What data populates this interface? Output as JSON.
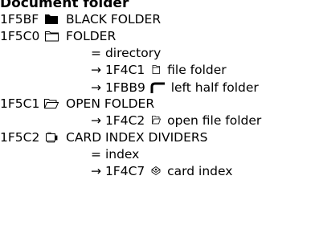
{
  "header": {
    "title": "Document folder"
  },
  "entries": [
    {
      "code": "1F5BF",
      "glyph": "🖿",
      "glyph_icon": "black-folder-icon",
      "name": "BLACK FOLDER",
      "notes": []
    },
    {
      "code": "1F5C0",
      "glyph": "🗀",
      "glyph_icon": "folder-icon",
      "name": "FOLDER",
      "notes": [
        {
          "prefix": "=",
          "text": "directory"
        },
        {
          "prefix": "→",
          "ref_code": "1F4C1",
          "ref_glyph": "📁",
          "text": "file folder"
        },
        {
          "prefix": "→",
          "ref_code": "1FBB9",
          "ref_glyph": "∩",
          "text": "left half folder"
        }
      ]
    },
    {
      "code": "1F5C1",
      "glyph": "🗁",
      "glyph_icon": "open-folder-icon",
      "name": "OPEN FOLDER",
      "notes": [
        {
          "prefix": "→",
          "ref_code": "1F4C2",
          "ref_glyph": "📂",
          "text": "open file folder"
        }
      ]
    },
    {
      "code": "1F5C2",
      "glyph": "🗂",
      "glyph_icon": "card-index-dividers-icon",
      "name": "CARD INDEX DIVIDERS",
      "notes": [
        {
          "prefix": "=",
          "text": "index"
        },
        {
          "prefix": "→",
          "ref_code": "1F4C7",
          "ref_glyph": "📇",
          "text": "card index"
        }
      ]
    }
  ]
}
